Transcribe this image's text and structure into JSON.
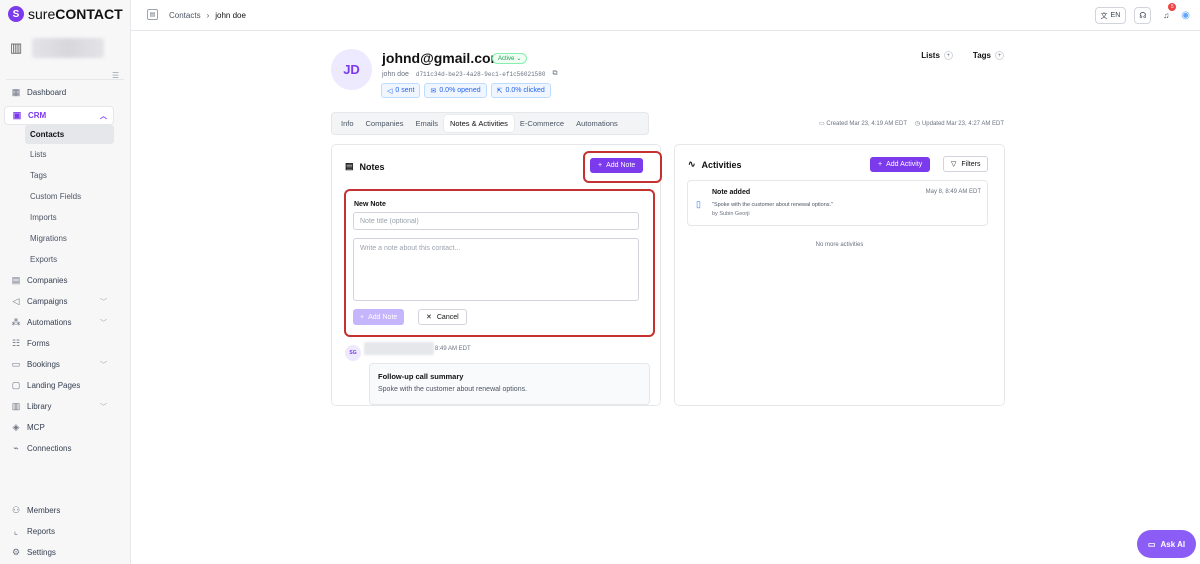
{
  "brand": {
    "logo_letter": "S",
    "name_light": "sure",
    "name_bold": "CONTACT"
  },
  "sidebar": {
    "items": [
      {
        "label": "Dashboard",
        "icon": "dashboard-icon"
      },
      {
        "label": "CRM",
        "icon": "crm-icon"
      },
      {
        "label": "Companies",
        "icon": "companies-icon"
      },
      {
        "label": "Campaigns",
        "icon": "campaigns-icon"
      },
      {
        "label": "Automations",
        "icon": "automations-icon"
      },
      {
        "label": "Forms",
        "icon": "forms-icon"
      },
      {
        "label": "Bookings",
        "icon": "bookings-icon"
      },
      {
        "label": "Landing Pages",
        "icon": "landing-pages-icon"
      },
      {
        "label": "Library",
        "icon": "library-icon"
      },
      {
        "label": "MCP",
        "icon": "mcp-icon"
      },
      {
        "label": "Connections",
        "icon": "connections-icon"
      }
    ],
    "crm_sub": [
      "Contacts",
      "Lists",
      "Tags",
      "Custom Fields",
      "Imports",
      "Migrations",
      "Exports"
    ],
    "bottom": [
      {
        "label": "Members",
        "icon": "members-icon"
      },
      {
        "label": "Reports",
        "icon": "reports-icon"
      },
      {
        "label": "Settings",
        "icon": "settings-icon"
      }
    ]
  },
  "topbar": {
    "crumb_root": "Contacts",
    "crumb_current": "john doe",
    "lang": "EN",
    "notif_count": "5"
  },
  "contact": {
    "initials": "JD",
    "email": "johnd@gmail.com",
    "status": "Active",
    "name": "john doe",
    "uuid": "d711c34d-be23-4a28-9ec1-ef1c56021580",
    "stats": {
      "sent": "0 sent",
      "opened": "0.0% opened",
      "clicked": "0.0% clicked"
    },
    "lists_label": "Lists",
    "tags_label": "Tags",
    "created": "Created Mar 23, 4:19 AM EDT",
    "updated": "Updated Mar 23, 4:27 AM EDT"
  },
  "tabs": [
    "Info",
    "Companies",
    "Emails",
    "Notes & Activities",
    "E-Commerce",
    "Automations"
  ],
  "notes": {
    "title": "Notes",
    "add_button": "Add Note",
    "form_label": "New Note",
    "title_placeholder": "Note title (optional)",
    "body_placeholder": "Write a note about this contact...",
    "submit_label": "Add Note",
    "cancel_label": "Cancel",
    "item": {
      "avatar": "SG",
      "time": "8:49 AM EDT",
      "title": "Follow-up call summary",
      "body": "Spoke with the customer about renewal options."
    }
  },
  "activities": {
    "title": "Activities",
    "add_button": "Add Activity",
    "filter_label": "Filters",
    "item": {
      "title": "Note added",
      "time": "May 8, 8:49 AM EDT",
      "desc": "\"Spoke with the customer about renewal options.\"",
      "by": "by Subin Georji"
    },
    "no_more": "No more activities"
  },
  "ask_ai": "Ask AI",
  "colors": {
    "primary": "#7c3aed",
    "highlight": "#c53030",
    "active": "#16a34a"
  }
}
